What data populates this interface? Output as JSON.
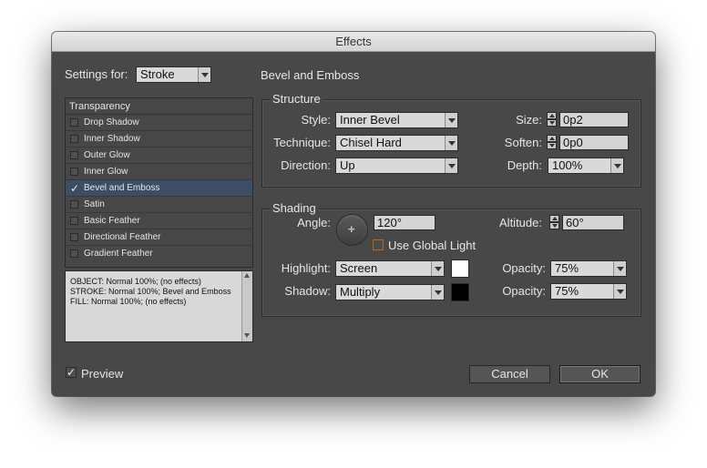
{
  "dialog": {
    "title": "Effects"
  },
  "settings_for": {
    "label": "Settings for:",
    "value": "Stroke"
  },
  "effects_list": {
    "header": "Transparency",
    "items": [
      {
        "label": "Drop Shadow",
        "checked": false,
        "selected": false
      },
      {
        "label": "Inner Shadow",
        "checked": false,
        "selected": false
      },
      {
        "label": "Outer Glow",
        "checked": false,
        "selected": false
      },
      {
        "label": "Inner Glow",
        "checked": false,
        "selected": false
      },
      {
        "label": "Bevel and Emboss",
        "checked": true,
        "selected": true
      },
      {
        "label": "Satin",
        "checked": false,
        "selected": false
      },
      {
        "label": "Basic Feather",
        "checked": false,
        "selected": false
      },
      {
        "label": "Directional Feather",
        "checked": false,
        "selected": false
      },
      {
        "label": "Gradient Feather",
        "checked": false,
        "selected": false
      }
    ]
  },
  "summary": {
    "lines": [
      "OBJECT: Normal 100%; (no effects)",
      "STROKE: Normal 100%; Bevel and Emboss",
      "FILL: Normal 100%; (no effects)"
    ]
  },
  "panel": {
    "title": "Bevel and Emboss"
  },
  "structure": {
    "legend": "Structure",
    "style_label": "Style:",
    "style_value": "Inner Bevel",
    "technique_label": "Technique:",
    "technique_value": "Chisel Hard",
    "direction_label": "Direction:",
    "direction_value": "Up",
    "size_label": "Size:",
    "size_value": "0p2",
    "soften_label": "Soften:",
    "soften_value": "0p0",
    "depth_label": "Depth:",
    "depth_value": "100%"
  },
  "shading": {
    "legend": "Shading",
    "angle_label": "Angle:",
    "angle_value": "120°",
    "altitude_label": "Altitude:",
    "altitude_value": "60°",
    "use_global_light_label": "Use Global Light",
    "use_global_light_checked": false,
    "highlight_label": "Highlight:",
    "highlight_mode": "Screen",
    "highlight_color": "#ffffff",
    "highlight_opacity_label": "Opacity:",
    "highlight_opacity": "75%",
    "shadow_label": "Shadow:",
    "shadow_mode": "Multiply",
    "shadow_color": "#000000",
    "shadow_opacity_label": "Opacity:",
    "shadow_opacity": "75%"
  },
  "footer": {
    "preview_label": "Preview",
    "preview_checked": true,
    "cancel_label": "Cancel",
    "ok_label": "OK"
  }
}
